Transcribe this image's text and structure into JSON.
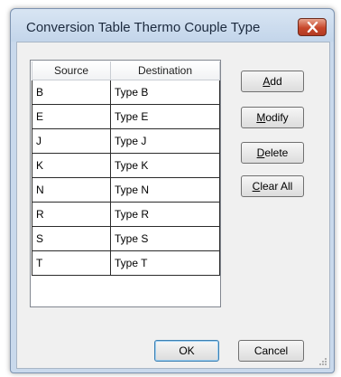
{
  "window": {
    "title": "Conversion Table Thermo Couple Type"
  },
  "table": {
    "columns": [
      "Source",
      "Destination"
    ],
    "rows": [
      {
        "source": "B",
        "destination": "Type B"
      },
      {
        "source": "E",
        "destination": "Type E"
      },
      {
        "source": "J",
        "destination": "Type J"
      },
      {
        "source": "K",
        "destination": "Type K"
      },
      {
        "source": "N",
        "destination": "Type N"
      },
      {
        "source": "R",
        "destination": "Type R"
      },
      {
        "source": "S",
        "destination": "Type S"
      },
      {
        "source": "T",
        "destination": "Type T"
      }
    ]
  },
  "buttons": {
    "add": {
      "mnemonic": "A",
      "rest": "dd"
    },
    "modify": {
      "mnemonic": "M",
      "rest": "odify"
    },
    "delete": {
      "mnemonic": "D",
      "rest": "elete"
    },
    "clear_all": {
      "mnemonic": "C",
      "rest": "lear All"
    },
    "ok": "OK",
    "cancel": "Cancel"
  },
  "icons": {
    "close": "close-icon",
    "grip": "resize-grip-icon"
  },
  "colors": {
    "close_button": "#c7472b",
    "titlebar": "#c9d9ec",
    "default_button_border": "#3c7fb1"
  }
}
